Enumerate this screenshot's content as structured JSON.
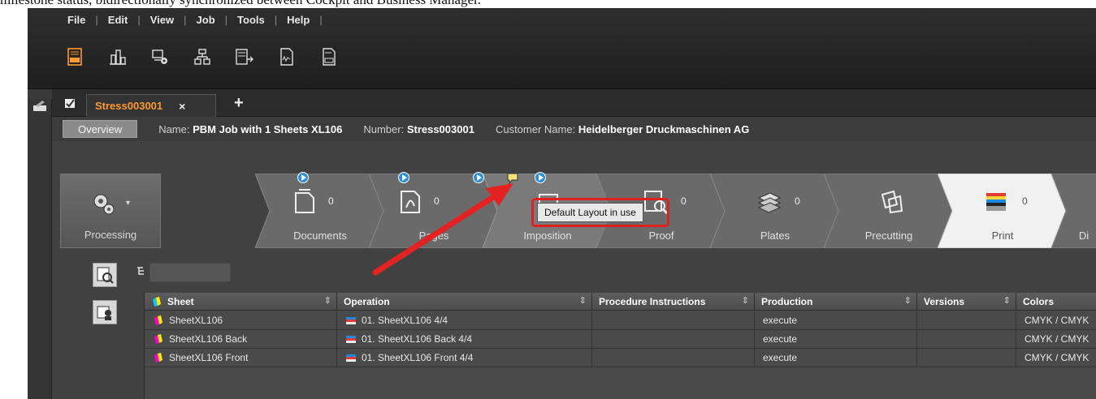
{
  "caption": "milestone status, bidirectionally synchronized between Cockpit and Business Manager.",
  "menu": [
    "File",
    "Edit",
    "View",
    "Job",
    "Tools",
    "Help"
  ],
  "toolbar": [
    {
      "icon": "abc-document-icon"
    },
    {
      "icon": "chart-bars-icon"
    },
    {
      "icon": "monitor-gear-icon"
    },
    {
      "icon": "hierarchy-icon"
    },
    {
      "icon": "abc-arrow-icon"
    },
    {
      "icon": "signature-document-icon"
    },
    {
      "icon": "ddd-document-icon"
    }
  ],
  "tab": {
    "title": "Stress003001",
    "close": "×",
    "add": "+"
  },
  "info": {
    "overview": "Overview",
    "name_label": "Name:",
    "name_value": "PBM Job with 1 Sheets XL106",
    "number_label": "Number:",
    "number_value": "Stress003001",
    "customer_label": "Customer Name:",
    "customer_value": "Heidelberger Druckmaschinen AG"
  },
  "processing": {
    "label": "Processing",
    "caret": "▾"
  },
  "milestones": [
    {
      "label": "Documents",
      "count": "0"
    },
    {
      "label": "Pages",
      "count": "0"
    },
    {
      "label": "Imposition",
      "count": ""
    },
    {
      "label": "Proof",
      "count": "0"
    },
    {
      "label": "Plates",
      "count": "0"
    },
    {
      "label": "Precutting",
      "count": ""
    },
    {
      "label": "Print",
      "count": "0"
    },
    {
      "label": "Di",
      "count": ""
    }
  ],
  "tooltip": "Default Layout in use",
  "table": {
    "columns": [
      "Sheet",
      "Operation",
      "Procedure Instructions",
      "Production",
      "Versions",
      "Colors"
    ],
    "sort_glyph": "⇕",
    "rows": [
      {
        "sheet": "SheetXL106",
        "operation": "01. SheetXL106 4/4",
        "instructions": "",
        "production": "execute",
        "versions": "",
        "colors": "CMYK / CMYK"
      },
      {
        "sheet": "SheetXL106 Back",
        "operation": "01. SheetXL106 Back 4/4",
        "instructions": "",
        "production": "execute",
        "versions": "",
        "colors": "CMYK / CMYK"
      },
      {
        "sheet": "SheetXL106 Front",
        "operation": "01. SheetXL106 Front 4/4",
        "instructions": "",
        "production": "execute",
        "versions": "",
        "colors": "CMYK / CMYK"
      }
    ]
  },
  "colors": {
    "accent": "#ff9a2e",
    "highlight": "#e02020",
    "play": "#2c8ed6"
  }
}
